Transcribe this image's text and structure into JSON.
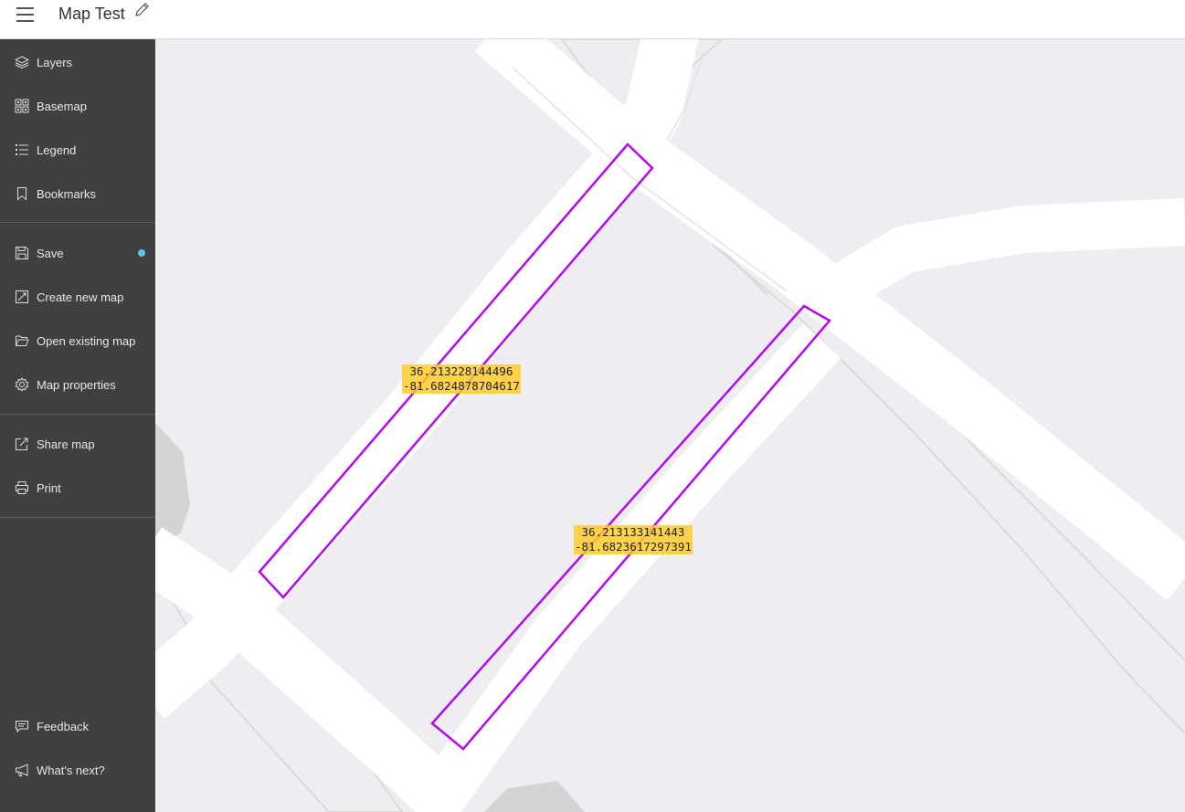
{
  "header": {
    "title": "Map Test"
  },
  "sidebar": {
    "items": [
      {
        "label": "Layers",
        "icon": "layers-icon"
      },
      {
        "label": "Basemap",
        "icon": "basemap-icon"
      },
      {
        "label": "Legend",
        "icon": "legend-icon"
      },
      {
        "label": "Bookmarks",
        "icon": "bookmark-icon"
      },
      {
        "label": "Save",
        "icon": "save-icon"
      },
      {
        "label": "Create new map",
        "icon": "new-map-icon"
      },
      {
        "label": "Open existing map",
        "icon": "folder-open-icon"
      },
      {
        "label": "Map properties",
        "icon": "gear-icon"
      },
      {
        "label": "Share map",
        "icon": "share-icon"
      },
      {
        "label": "Print",
        "icon": "printer-icon"
      },
      {
        "label": "Feedback",
        "icon": "feedback-icon"
      },
      {
        "label": "What's next?",
        "icon": "megaphone-icon"
      }
    ]
  },
  "map": {
    "features": [
      {
        "lat": "36.213228144496",
        "lon": "-81.6824878704617"
      },
      {
        "lat": "36.213133141443",
        "lon": "-81.6823617297391"
      }
    ]
  },
  "colors": {
    "sidebar": "#404040",
    "map_background": "#efedf2",
    "road": "#ffffff",
    "polygon_outline": "#b10af0",
    "label_highlight": "#ffcd28",
    "unsaved_dot": "#5ec3f2"
  }
}
